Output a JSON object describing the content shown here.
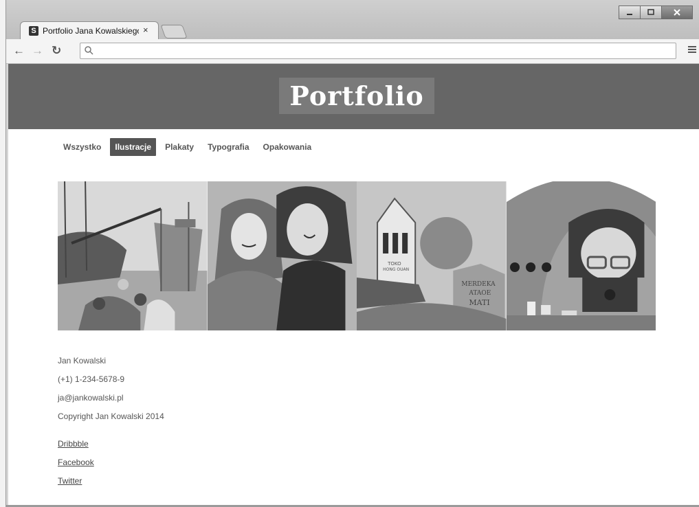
{
  "browser": {
    "tab_title": "Portfolio Jana Kowalskiego",
    "tab_favicon": "S",
    "tab_close": "×",
    "address": ""
  },
  "header": {
    "logo": "Portfolio"
  },
  "filters": [
    {
      "label": "Wszystko",
      "active": false
    },
    {
      "label": "Ilustracje",
      "active": true
    },
    {
      "label": "Plakaty",
      "active": false
    },
    {
      "label": "Typografia",
      "active": false
    },
    {
      "label": "Opakowania",
      "active": false
    }
  ],
  "gallery": [
    {
      "name": "ships-illustration"
    },
    {
      "name": "two-girls-illustration"
    },
    {
      "name": "merdeka-street-illustration"
    },
    {
      "name": "girl-at-laptop-illustration"
    }
  ],
  "footer": {
    "name": "Jan Kowalski",
    "phone": "(+1) 1-234-5678-9",
    "email": "ja@jankowalski.pl",
    "copyright": "Copyright Jan Kowalski 2014",
    "links": [
      "Dribbble",
      "Facebook",
      "Twitter"
    ]
  },
  "artwork_text": {
    "shop_sign_1": "TOKO",
    "shop_sign_2": "HONG OUAN",
    "wall_1": "MERDEKA",
    "wall_2": "ATAOE",
    "wall_3": "MATI"
  }
}
